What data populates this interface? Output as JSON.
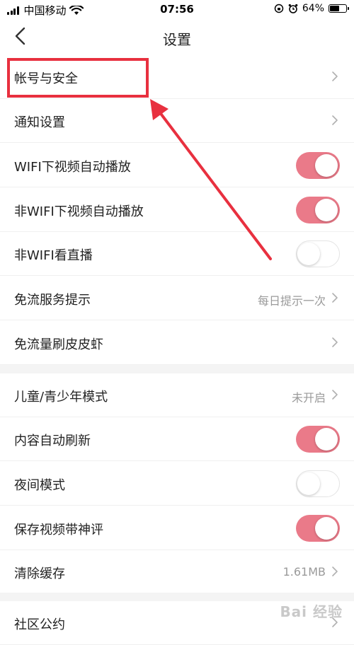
{
  "status_bar": {
    "carrier": "中国移动",
    "time": "07:56",
    "battery_text": "64%",
    "battery_level": 0.64
  },
  "nav": {
    "title": "设置"
  },
  "rows": [
    {
      "label": "帐号与安全",
      "control": "chevron"
    },
    {
      "label": "通知设置",
      "control": "chevron"
    },
    {
      "label": "WIFI下视频自动播放",
      "control": "toggle",
      "on": true
    },
    {
      "label": "非WIFI下视频自动播放",
      "control": "toggle",
      "on": true
    },
    {
      "label": "非WIFI看直播",
      "control": "toggle",
      "on": false
    },
    {
      "label": "免流服务提示",
      "control": "chevron",
      "value": "每日提示一次"
    },
    {
      "label": "免流量刷皮皮虾",
      "control": "chevron"
    },
    {
      "label": "儿童/青少年模式",
      "control": "chevron",
      "value": "未开启"
    },
    {
      "label": "内容自动刷新",
      "control": "toggle",
      "on": true
    },
    {
      "label": "夜间模式",
      "control": "toggle",
      "on": false
    },
    {
      "label": "保存视频带神评",
      "control": "toggle",
      "on": true
    },
    {
      "label": "清除缓存",
      "control": "chevron",
      "value": "1.61MB"
    },
    {
      "label": "社区公约",
      "control": "chevron"
    }
  ],
  "watermark": "Bai 经验",
  "colors": {
    "toggle_on": "#ea7a89",
    "highlight": "#e8303f"
  }
}
